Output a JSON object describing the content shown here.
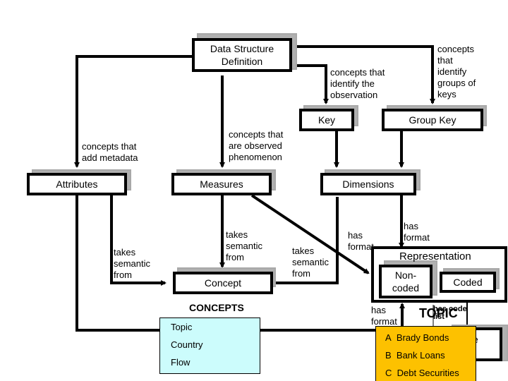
{
  "nodes": {
    "dsd": "Data Structure\nDefinition",
    "key": "Key",
    "group_key": "Group Key",
    "attributes": "Attributes",
    "measures": "Measures",
    "dimensions": "Dimensions",
    "concept": "Concept",
    "representation": "Representation",
    "non_coded": "Non-\ncoded",
    "coded": "Coded",
    "code_list_partial": "e\nt"
  },
  "edge_labels": {
    "add_metadata": "concepts that\nadd metadata",
    "observed_phenomenon": "concepts that\nare observed\nphenomenon",
    "identify_observation": "concepts that\nidentify the\nobservation",
    "identify_groups": "concepts\nthat\nidentify\ngroups of\nkeys",
    "attr_semantic": "takes\nsemantic\nfrom",
    "measures_semantic": "takes\nsemantic\nfrom",
    "dims_semantic": "takes\nsemantic\nfrom",
    "measures_format": "has\nformat",
    "dims_format": "has\nformat",
    "attr_format": "has\nformat",
    "has_code_list": "has code\nlist"
  },
  "concepts_panel": {
    "title": "CONCEPTS",
    "items": [
      "Topic",
      "Country",
      "Flow"
    ]
  },
  "topic_panel": {
    "title": "TOPIC",
    "items": [
      {
        "code": "A",
        "label": "Brady Bonds"
      },
      {
        "code": "B",
        "label": "Bank Loans"
      },
      {
        "code": "C",
        "label": "Debt Securities"
      }
    ]
  },
  "colors": {
    "concepts_fill": "#ccfcfc",
    "topic_fill": "#fdc100",
    "shadow": "#b0b0b0"
  }
}
